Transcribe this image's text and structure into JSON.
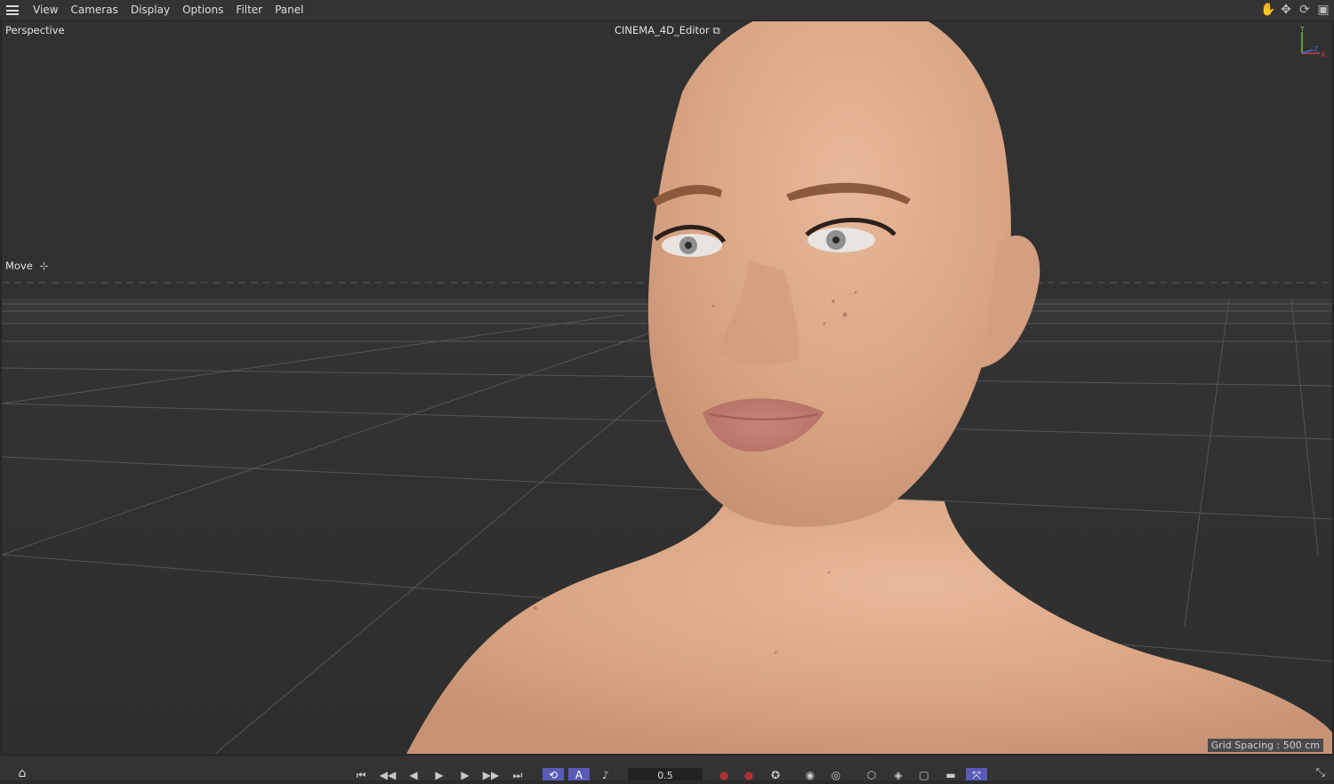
{
  "menu": {
    "items": [
      "View",
      "Cameras",
      "Display",
      "Options",
      "Filter",
      "Panel"
    ]
  },
  "nav_icons": [
    "hand-pan-icon",
    "move-arrows-icon",
    "rotate-icon",
    "maximize-icon"
  ],
  "viewport": {
    "camera_label": "Perspective",
    "title": "CINEMA_4D_Editor",
    "tool_label": "Move",
    "grid_spacing": "Grid Spacing : 500 cm",
    "axis": {
      "y": "Y",
      "z": "Z",
      "x": "X"
    }
  },
  "timeline": {
    "frame_value": "0.5",
    "buttons": [
      "go-start-icon",
      "prev-key-icon",
      "prev-frame-icon",
      "play-icon",
      "next-frame-icon",
      "next-key-icon",
      "go-end-icon",
      "loop-icon",
      "auto-key-icon",
      "sound-icon",
      "record-icon",
      "autokey-record-icon",
      "keyframe-icon",
      "pos-key-icon",
      "rot-key-icon",
      "scale-key-icon",
      "param-key-icon",
      "pla-key-icon",
      "points-key-icon"
    ]
  },
  "colors": {
    "background": "#313131",
    "menubar": "#333333",
    "skin": "#d9a888",
    "active": "#5a5ab8",
    "record": "#b03030"
  }
}
